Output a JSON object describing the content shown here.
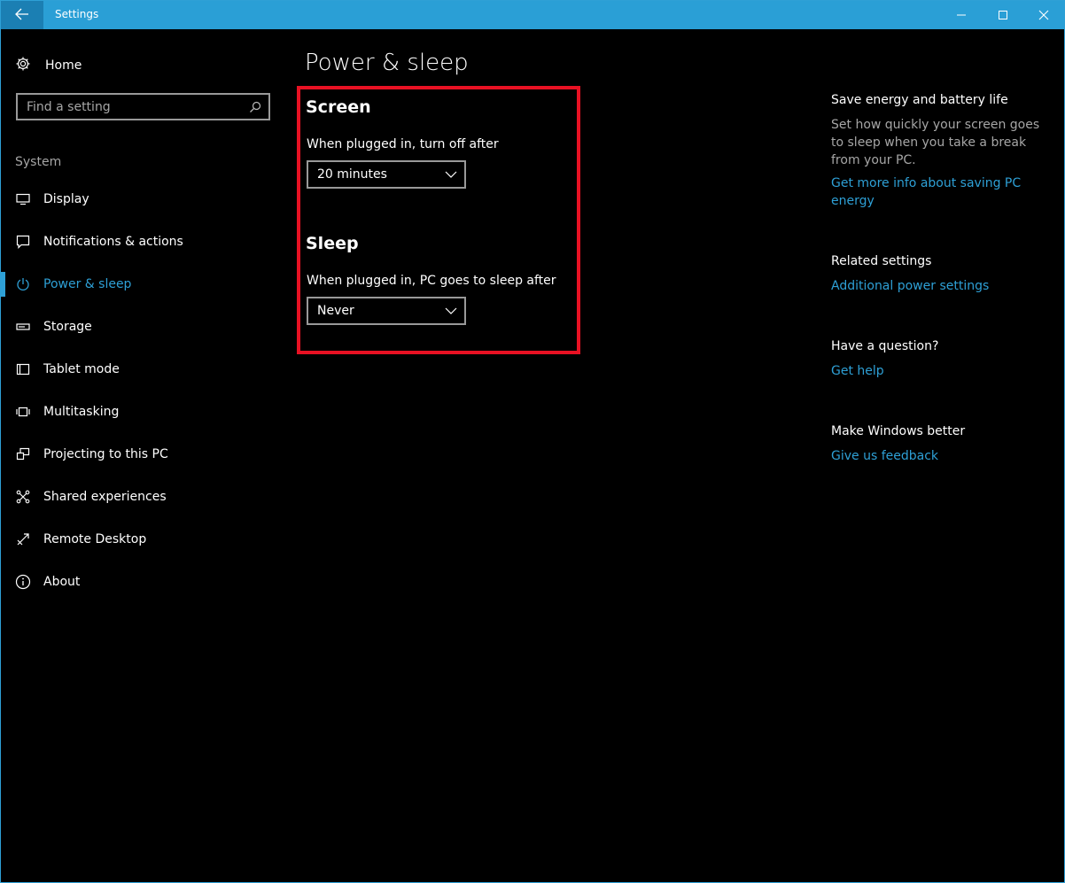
{
  "window": {
    "title": "Settings",
    "accent": "#2ea0d6",
    "highlight_color": "#e81123",
    "icons": {
      "back": "back-arrow-icon",
      "minimize": "minimize-icon",
      "maximize": "maximize-icon",
      "close": "close-icon"
    }
  },
  "sidebar": {
    "home_label": "Home",
    "search_placeholder": "Find a setting",
    "section_label": "System",
    "items": [
      {
        "label": "Display",
        "icon": "monitor-icon"
      },
      {
        "label": "Notifications & actions",
        "icon": "notification-icon"
      },
      {
        "label": "Power & sleep",
        "icon": "power-icon",
        "active": true
      },
      {
        "label": "Storage",
        "icon": "storage-icon"
      },
      {
        "label": "Tablet mode",
        "icon": "tablet-icon"
      },
      {
        "label": "Multitasking",
        "icon": "multitasking-icon"
      },
      {
        "label": "Projecting to this PC",
        "icon": "projecting-icon"
      },
      {
        "label": "Shared experiences",
        "icon": "shared-icon"
      },
      {
        "label": "Remote Desktop",
        "icon": "remote-desktop-icon"
      },
      {
        "label": "About",
        "icon": "info-icon"
      }
    ]
  },
  "main": {
    "title": "Power & sleep",
    "screen": {
      "heading": "Screen",
      "label": "When plugged in, turn off after",
      "value": "20 minutes"
    },
    "sleep": {
      "heading": "Sleep",
      "label": "When plugged in, PC goes to sleep after",
      "value": "Never"
    }
  },
  "right": {
    "save_energy": {
      "heading": "Save energy and battery life",
      "text": "Set how quickly your screen goes to sleep when you take a break from your PC.",
      "link": "Get more info about saving PC energy"
    },
    "related": {
      "heading": "Related settings",
      "link": "Additional power settings"
    },
    "question": {
      "heading": "Have a question?",
      "link": "Get help"
    },
    "feedback": {
      "heading": "Make Windows better",
      "link": "Give us feedback"
    }
  }
}
